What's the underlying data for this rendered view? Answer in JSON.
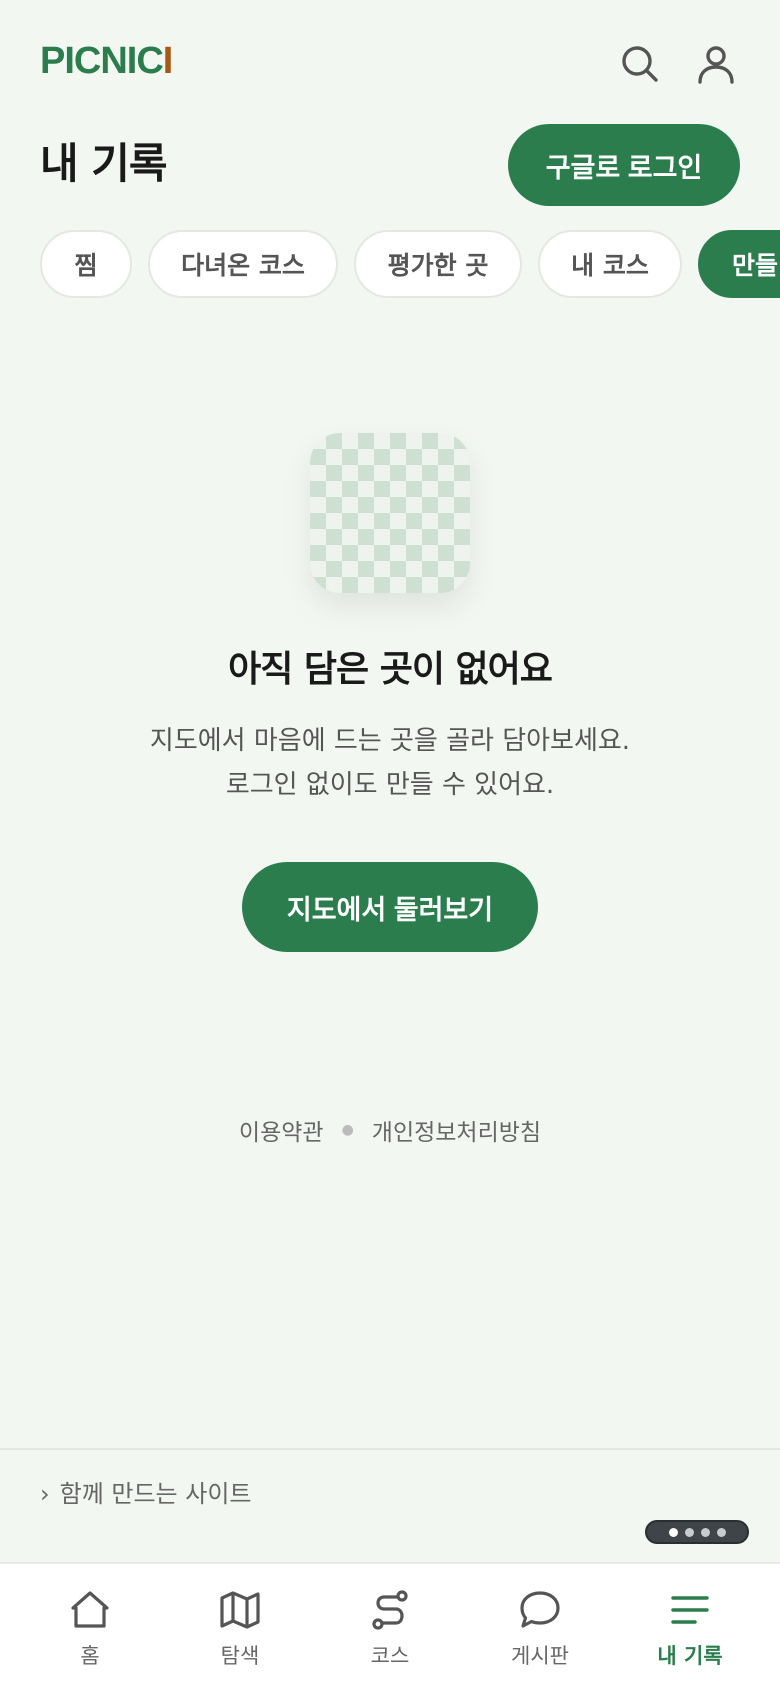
{
  "header": {
    "logo_main": "PICNIC",
    "logo_accent": "I",
    "search_icon": "search-icon",
    "user_icon": "user-icon"
  },
  "page": {
    "title": "내 기록",
    "login_label": "구글로 로그인"
  },
  "tabs": [
    {
      "label": "찜"
    },
    {
      "label": "다녀온 코스"
    },
    {
      "label": "평가한 곳"
    },
    {
      "label": "내 코스"
    },
    {
      "label": "만들",
      "active": true
    }
  ],
  "empty_state": {
    "title": "아직 담은 곳이 없어요",
    "desc_line1": "지도에서 마음에 드는 곳을 골라 담아보세요.",
    "desc_line2": "로그인 없이도 만들 수 있어요.",
    "cta_label": "지도에서 둘러보기"
  },
  "footer": {
    "terms": "이용약관",
    "privacy": "개인정보처리방침",
    "together": "함께 만드는 사이트"
  },
  "pager": {
    "count": 4,
    "active_index": 0
  },
  "bottom_nav": [
    {
      "label": "홈",
      "icon": "home-icon"
    },
    {
      "label": "탐색",
      "icon": "map-icon"
    },
    {
      "label": "코스",
      "icon": "route-icon"
    },
    {
      "label": "게시판",
      "icon": "chat-icon"
    },
    {
      "label": "내 기록",
      "icon": "menu-icon",
      "active": true
    }
  ],
  "colors": {
    "brand": "#2b7d4e",
    "logo_accent": "#a85a14",
    "background": "#f3f7f2"
  }
}
